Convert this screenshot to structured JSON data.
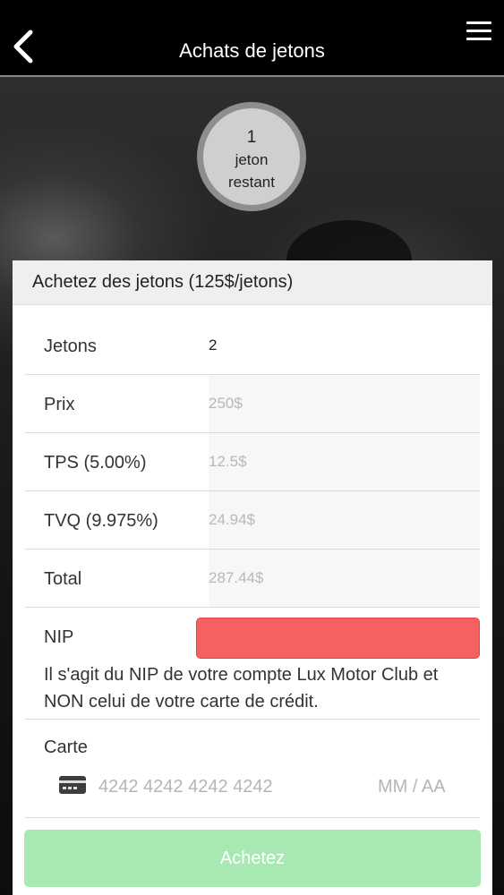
{
  "nav": {
    "title": "Achats de jetons",
    "back_icon": "chevron-left-icon",
    "menu_icon": "hamburger-menu-icon"
  },
  "tokens": {
    "count": "1",
    "line1": "jeton",
    "line2": "restant"
  },
  "form": {
    "header": "Achetez des jetons (125$/jetons)",
    "rows": [
      {
        "label": "Jetons",
        "value": "2"
      },
      {
        "label": "Prix",
        "value": "250$"
      },
      {
        "label": "TPS (5.00%)",
        "value": "12.5$"
      },
      {
        "label": "TVQ (9.975%)",
        "value": "24.94$"
      },
      {
        "label": "Total",
        "value": "287.44$"
      }
    ],
    "nip_label": "NIP",
    "nip_value": "",
    "nip_note": "Il s'agit du NIP de votre compte Lux Motor Club et NON celui de votre carte de crédit.",
    "card_label": "Carte",
    "card_icon": "credit-card-icon",
    "card_number_placeholder": "4242 4242 4242 4242",
    "card_expiry_placeholder": "MM / AA",
    "submit_label": "Achetez"
  },
  "colors": {
    "nip_error": "#f56160",
    "submit_disabled": "#a7e8b3"
  }
}
